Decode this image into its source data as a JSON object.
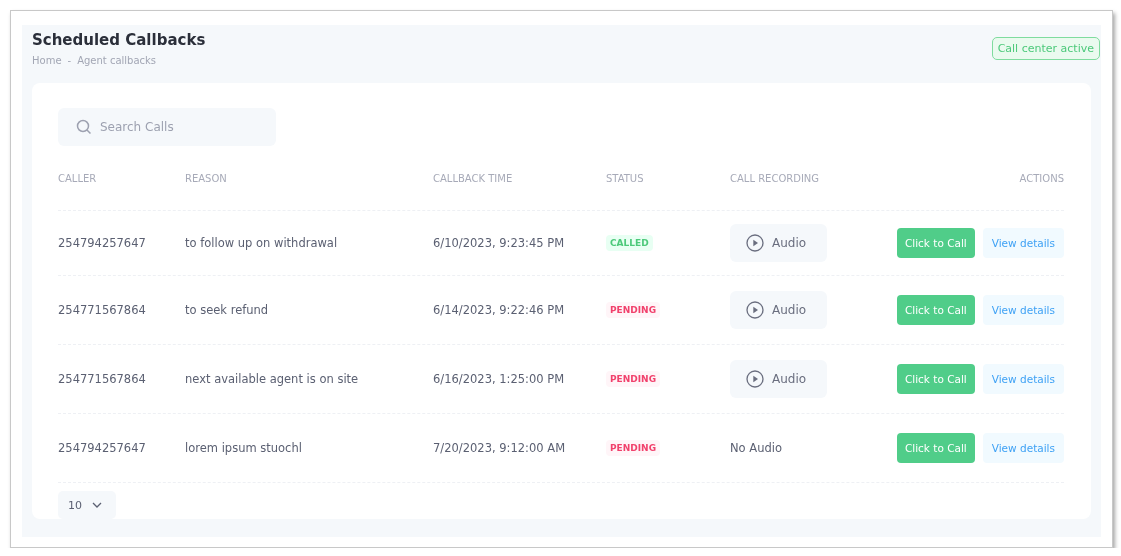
{
  "header": {
    "title": "Scheduled Callbacks",
    "breadcrumb": [
      "Home",
      "Agent callbacks"
    ],
    "separator": "-",
    "status_badge": "Call center active"
  },
  "search": {
    "placeholder": "Search Calls"
  },
  "table": {
    "columns": [
      "CALLER",
      "REASON",
      "CALLBACK TIME",
      "STATUS",
      "CALL RECORDING",
      "ACTIONS"
    ],
    "rows": [
      {
        "caller": "254794257647",
        "reason": "to follow up on withdrawal",
        "time": "6/10/2023, 9:23:45 PM",
        "status": {
          "kind": "called",
          "label": "CALLED"
        },
        "recording": {
          "kind": "audio",
          "label": "Audio"
        },
        "call_button": "Click to Call",
        "details_button": "View details"
      },
      {
        "caller": "254771567864",
        "reason": "to seek refund",
        "time": "6/14/2023, 9:22:46 PM",
        "status": {
          "kind": "pending",
          "label": "PENDING"
        },
        "recording": {
          "kind": "audio",
          "label": "Audio"
        },
        "call_button": "Click to Call",
        "details_button": "View details"
      },
      {
        "caller": "254771567864",
        "reason": "next available agent is on site",
        "time": "6/16/2023, 1:25:00 PM",
        "status": {
          "kind": "pending",
          "label": "PENDING"
        },
        "recording": {
          "kind": "audio",
          "label": "Audio"
        },
        "call_button": "Click to Call",
        "details_button": "View details"
      },
      {
        "caller": "254794257647",
        "reason": "lorem ipsum stuochl",
        "time": "7/20/2023, 9:12:00 AM",
        "status": {
          "kind": "pending",
          "label": "PENDING"
        },
        "recording": {
          "kind": "none",
          "label": "No Audio"
        },
        "call_button": "Click to Call",
        "details_button": "View details"
      }
    ]
  },
  "page_size": "10"
}
